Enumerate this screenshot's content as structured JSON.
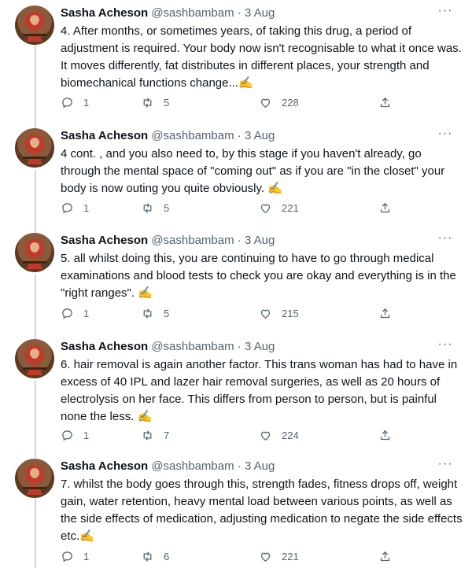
{
  "tweets": [
    {
      "name": "Sasha Acheson",
      "handle": "@sashbambam",
      "dot": "·",
      "date": "3 Aug",
      "text": "4. After months, or sometimes years, of taking this drug, a period of adjustment is required. Your body now isn't recognisable to what it once was. It moves differently, fat distributes in different places, your strength and biomechanical functions change...✍️",
      "replies": "1",
      "retweets": "5",
      "likes": "228"
    },
    {
      "name": "Sasha Acheson",
      "handle": "@sashbambam",
      "dot": "·",
      "date": "3 Aug",
      "text": "4 cont. , and you also need to, by this stage if you haven't already, go through the mental space of \"coming out\" as if you are \"in the closet\" your body is now outing you quite obviously. ✍️",
      "replies": "1",
      "retweets": "5",
      "likes": "221"
    },
    {
      "name": "Sasha Acheson",
      "handle": "@sashbambam",
      "dot": "·",
      "date": "3 Aug",
      "text": "5. all whilst doing this, you are continuing to have to go through medical examinations and blood tests to check you are okay and everything is in the \"right ranges\". ✍️",
      "replies": "1",
      "retweets": "5",
      "likes": "215"
    },
    {
      "name": "Sasha Acheson",
      "handle": "@sashbambam",
      "dot": "·",
      "date": "3 Aug",
      "text": "6. hair removal is again another factor. This trans woman has had to have in excess of 40 IPL and lazer hair removal surgeries, as well as 20 hours of electrolysis on her face. This differs from person to person, but is painful none the less. ✍️",
      "replies": "1",
      "retweets": "7",
      "likes": "224"
    },
    {
      "name": "Sasha Acheson",
      "handle": "@sashbambam",
      "dot": "·",
      "date": "3 Aug",
      "text": "7. whilst the body goes through this, strength fades, fitness drops off, weight gain, water retention, heavy mental load between various points, as well as the side effects of medication, adjusting medication to negate the side effects etc.✍️",
      "replies": "1",
      "retweets": "6",
      "likes": "221"
    }
  ],
  "icons": {
    "reply": "reply-icon",
    "retweet": "retweet-icon",
    "like": "heart-icon",
    "share": "share-icon",
    "more": "more-icon"
  },
  "colors": {
    "text": "#0f1419",
    "muted": "#536471",
    "thread_line": "#cfd9de"
  }
}
